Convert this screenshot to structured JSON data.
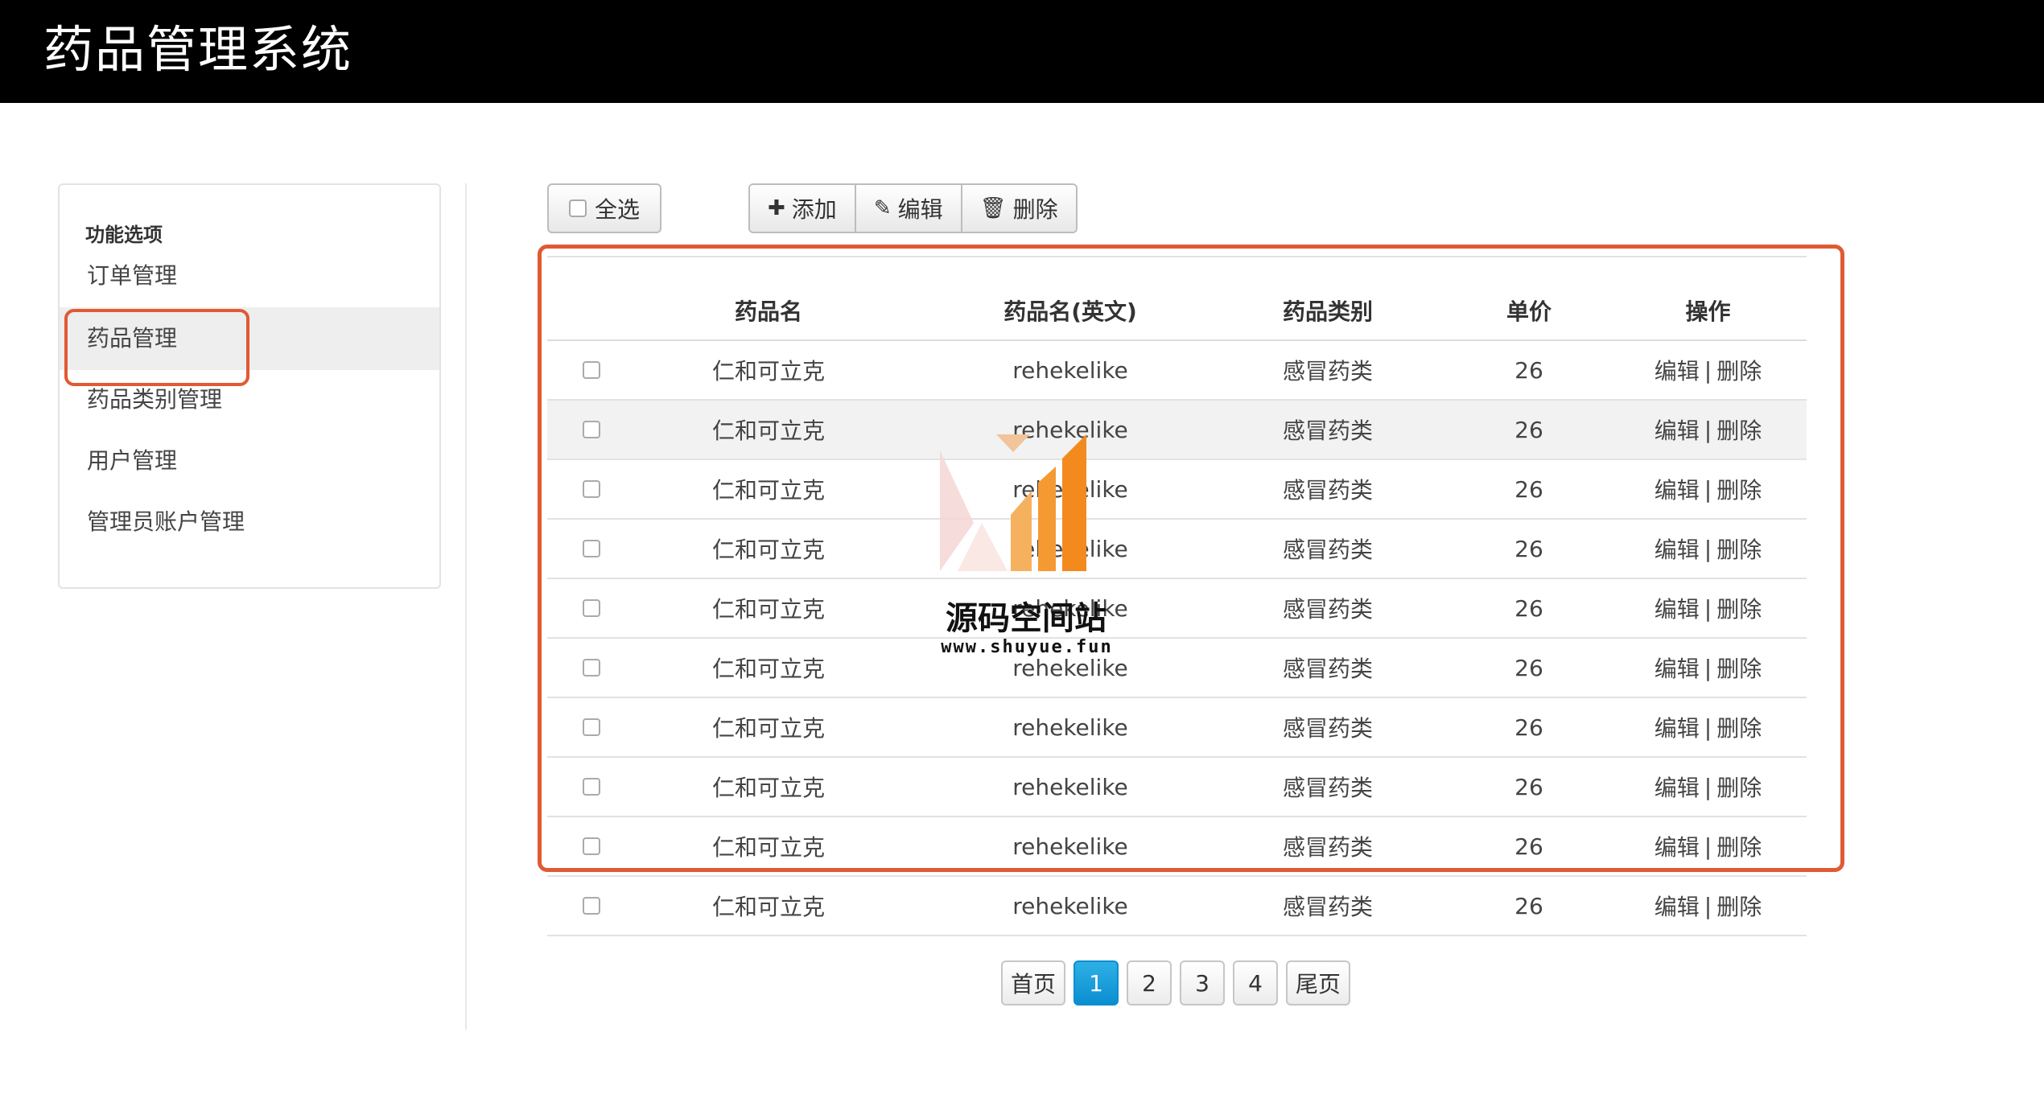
{
  "app": {
    "title": "药品管理系统"
  },
  "sidebar": {
    "header": "功能选项",
    "items": [
      {
        "label": "订单管理",
        "active": false
      },
      {
        "label": "药品管理",
        "active": true
      },
      {
        "label": "药品类别管理",
        "active": false
      },
      {
        "label": "用户管理",
        "active": false
      },
      {
        "label": "管理员账户管理",
        "active": false
      }
    ]
  },
  "toolbar": {
    "select_all_label": "全选",
    "add_label": "添加",
    "edit_label": "编辑",
    "delete_label": "删除"
  },
  "table": {
    "columns": [
      "药品名",
      "药品名(英文)",
      "药品类别",
      "单价",
      "操作"
    ],
    "rows": [
      {
        "name": "仁和可立克",
        "name_en": "rehekelike",
        "category": "感冒药类",
        "price": "26"
      },
      {
        "name": "仁和可立克",
        "name_en": "rehekelike",
        "category": "感冒药类",
        "price": "26"
      },
      {
        "name": "仁和可立克",
        "name_en": "rehekelike",
        "category": "感冒药类",
        "price": "26"
      },
      {
        "name": "仁和可立克",
        "name_en": "rehekelike",
        "category": "感冒药类",
        "price": "26"
      },
      {
        "name": "仁和可立克",
        "name_en": "rehekelike",
        "category": "感冒药类",
        "price": "26"
      },
      {
        "name": "仁和可立克",
        "name_en": "rehekelike",
        "category": "感冒药类",
        "price": "26"
      },
      {
        "name": "仁和可立克",
        "name_en": "rehekelike",
        "category": "感冒药类",
        "price": "26"
      },
      {
        "name": "仁和可立克",
        "name_en": "rehekelike",
        "category": "感冒药类",
        "price": "26"
      },
      {
        "name": "仁和可立克",
        "name_en": "rehekelike",
        "category": "感冒药类",
        "price": "26"
      },
      {
        "name": "仁和可立克",
        "name_en": "rehekelike",
        "category": "感冒药类",
        "price": "26"
      }
    ],
    "row_edit_label": "编辑",
    "row_separator": "|",
    "row_delete_label": "删除"
  },
  "pagination": {
    "first_label": "首页",
    "pages": [
      "1",
      "2",
      "3",
      "4"
    ],
    "current_page": "1",
    "last_label": "尾页"
  },
  "watermark": {
    "title": "源码空间站",
    "url": "www.shuyue.fun"
  },
  "colors": {
    "header_bg": "#000000",
    "highlight_border": "#e05a33",
    "active_page": "#0b8ed0",
    "watermark_orange": "#f28a1e"
  },
  "icons": {
    "add": "plus-icon",
    "edit": "edit-icon",
    "delete": "trash-icon"
  }
}
